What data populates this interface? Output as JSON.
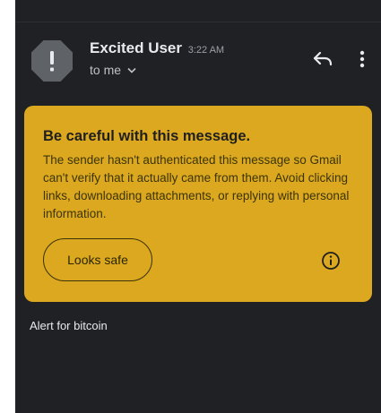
{
  "email": {
    "sender_name": "Excited User",
    "time": "3:22 AM",
    "recipient": "to me",
    "body_text": "Alert for bitcoin"
  },
  "icons": {
    "avatar": "exclamation-octagon-icon",
    "recipient_toggle": "chevron-down-icon",
    "reply": "reply-arrow-icon",
    "more": "more-vert-icon",
    "info": "info-circle-icon"
  },
  "warning": {
    "title": "Be careful with this message.",
    "body": "The sender hasn't authenticated this message so Gmail can't verify that it actually came from them. Avoid clicking links, downloading attachments, or replying with personal information.",
    "button_label": "Looks safe"
  },
  "colors": {
    "background": "#202124",
    "warning_card": "#dba81f",
    "avatar": "#5f6368",
    "text_primary": "#e8eaed",
    "text_secondary": "#9aa0a6"
  }
}
